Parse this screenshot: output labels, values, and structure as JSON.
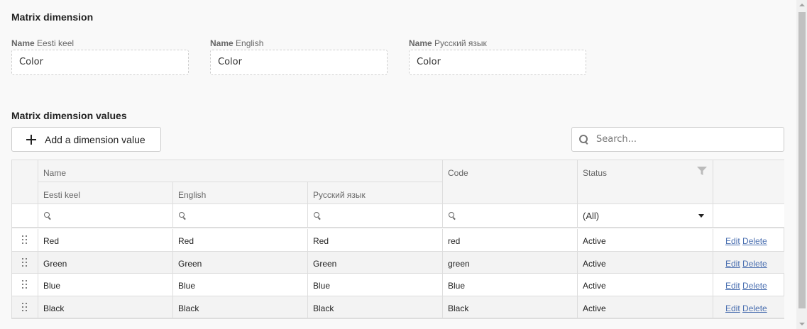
{
  "dimension": {
    "title": "Matrix dimension",
    "fields": [
      {
        "label_bold": "Name",
        "label_rest": " Eesti keel",
        "value": "Color"
      },
      {
        "label_bold": "Name",
        "label_rest": " English",
        "value": "Color"
      },
      {
        "label_bold": "Name",
        "label_rest": " Русский язык",
        "value": "Color"
      }
    ]
  },
  "values_section": {
    "title": "Matrix dimension values",
    "add_label": "Add a dimension value",
    "search_placeholder": "Search..."
  },
  "grid": {
    "headers": {
      "name": "Name",
      "et": "Eesti keel",
      "en": "English",
      "ru": "Русский язык",
      "code": "Code",
      "status": "Status"
    },
    "status_filter": "(All)",
    "rows": [
      {
        "et": "Red",
        "en": "Red",
        "ru": "Red",
        "code": "red",
        "status": "Active",
        "edit": "Edit",
        "delete": "Delete"
      },
      {
        "et": "Green",
        "en": "Green",
        "ru": "Green",
        "code": "green",
        "status": "Active",
        "edit": "Edit",
        "delete": "Delete"
      },
      {
        "et": "Blue",
        "en": "Blue",
        "ru": "Blue",
        "code": "Blue",
        "status": "Active",
        "edit": "Edit",
        "delete": "Delete"
      },
      {
        "et": "Black",
        "en": "Black",
        "ru": "Black",
        "code": "Black",
        "status": "Active",
        "edit": "Edit",
        "delete": "Delete"
      }
    ]
  },
  "colors": {
    "link": "#4a6fb0",
    "border": "#dddddd",
    "header_bg": "#f5f5f5",
    "alt_row": "#f3f3f3"
  }
}
